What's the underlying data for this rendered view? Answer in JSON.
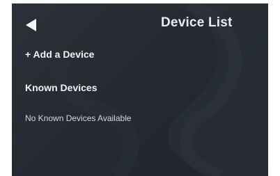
{
  "header": {
    "back_icon": "back-triangle-icon",
    "title": "Device List"
  },
  "actions": {
    "add_device_label": "+ Add a Device"
  },
  "known_devices": {
    "heading": "Known Devices",
    "empty_message": "No Known Devices Available",
    "items": []
  },
  "colors": {
    "background": "#252a31",
    "text": "#ffffff",
    "muted_text": "#d6d9dc"
  }
}
